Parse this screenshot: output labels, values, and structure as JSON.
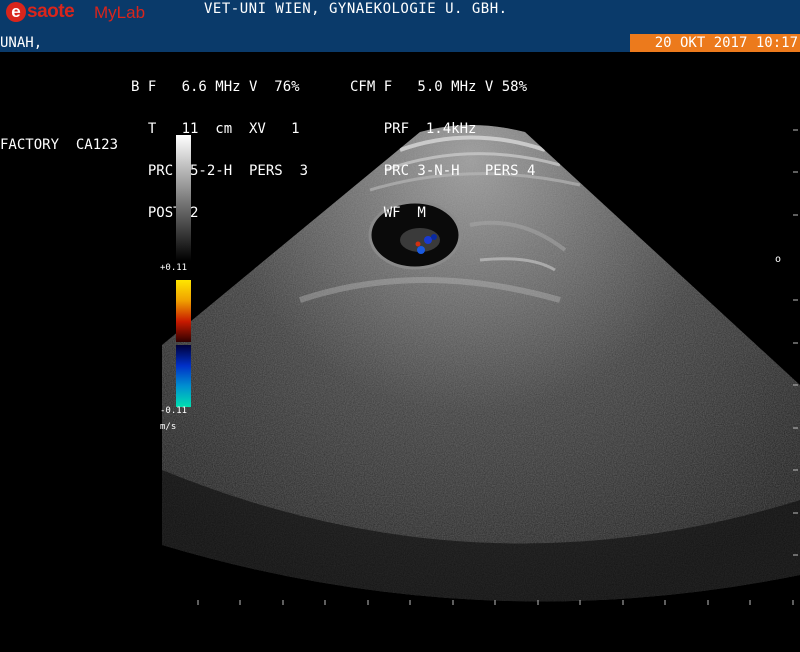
{
  "header": {
    "brand_e": "e",
    "brand_name": "saote",
    "brand_product": "MyLab",
    "institution": "VET-UNI WIEN, GYNAEKOLOGIE U. GBH.",
    "patient": "UNAH,",
    "datetime": "20 OKT 2017 10:17"
  },
  "params_left": [
    "B F   6.6 MHz V  76%",
    "  T   11  cm  XV   1",
    "  PRC 15-2-H  PERS  3",
    "  POST 2"
  ],
  "params_right": [
    "CFM F   5.0 MHz V 58%",
    "    PRF  1.4kHz",
    "    PRC 3-N-H   PERS 4",
    "    WF  M"
  ],
  "preset": "FACTORY  CA123",
  "color_scale": {
    "top": "+0.11",
    "bottom": "-0.11",
    "unit": "m/s"
  },
  "colors": {
    "header_bg": "#0a3a6a",
    "datetime_bg": "#ec7a1c",
    "brand": "#d9251c"
  },
  "side_mark": "o"
}
